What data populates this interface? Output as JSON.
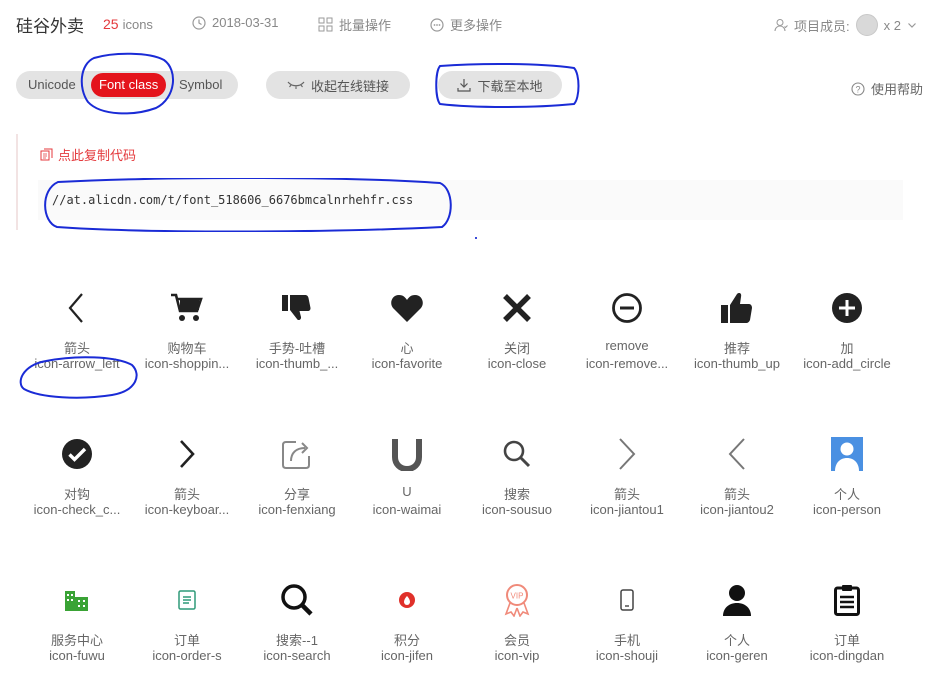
{
  "header": {
    "title": "硅谷外卖",
    "icon_count": "25",
    "icon_unit": "icons",
    "date": "2018-03-31",
    "batch_action": "批量操作",
    "more_action": "更多操作",
    "members_label": "项目成员:",
    "members_count": "x 2"
  },
  "tabs": {
    "unicode": "Unicode",
    "font_class": "Font class",
    "symbol": "Symbol"
  },
  "buttons": {
    "collapse_link": "收起在线链接",
    "download": "下载至本地",
    "help": "使用帮助"
  },
  "code": {
    "copy_label": "点此复制代码",
    "css_url": "//at.alicdn.com/t/font_518606_6676bmcalnrhehfr.css"
  },
  "icons": [
    {
      "name": "箭头",
      "cls": "icon-arrow_left"
    },
    {
      "name": "购物车",
      "cls": "icon-shoppin..."
    },
    {
      "name": "手势-吐槽",
      "cls": "icon-thumb_..."
    },
    {
      "name": "心",
      "cls": "icon-favorite"
    },
    {
      "name": "关闭",
      "cls": "icon-close"
    },
    {
      "name": "remove",
      "cls": "icon-remove..."
    },
    {
      "name": "推荐",
      "cls": "icon-thumb_up"
    },
    {
      "name": "加",
      "cls": "icon-add_circle"
    },
    {
      "name": "对钩",
      "cls": "icon-check_c..."
    },
    {
      "name": "箭头",
      "cls": "icon-keyboar..."
    },
    {
      "name": "分享",
      "cls": "icon-fenxiang"
    },
    {
      "name": "U",
      "cls": "icon-waimai"
    },
    {
      "name": "搜索",
      "cls": "icon-sousuo"
    },
    {
      "name": "箭头",
      "cls": "icon-jiantou1"
    },
    {
      "name": "箭头",
      "cls": "icon-jiantou2"
    },
    {
      "name": "个人",
      "cls": "icon-person"
    },
    {
      "name": "服务中心",
      "cls": "icon-fuwu"
    },
    {
      "name": "订单",
      "cls": "icon-order-s"
    },
    {
      "name": "搜索--1",
      "cls": "icon-search"
    },
    {
      "name": "积分",
      "cls": "icon-jifen"
    },
    {
      "name": "会员",
      "cls": "icon-vip"
    },
    {
      "name": "手机",
      "cls": "icon-shouji"
    },
    {
      "name": "个人",
      "cls": "icon-geren"
    },
    {
      "name": "订单",
      "cls": "icon-dingdan"
    }
  ],
  "colors": {
    "accent_red": "#e4141c",
    "annotation_blue": "#1a2bd6",
    "vip_salmon": "#f08a7a",
    "green": "#3aa335",
    "person_blue": "#4a90e2"
  }
}
